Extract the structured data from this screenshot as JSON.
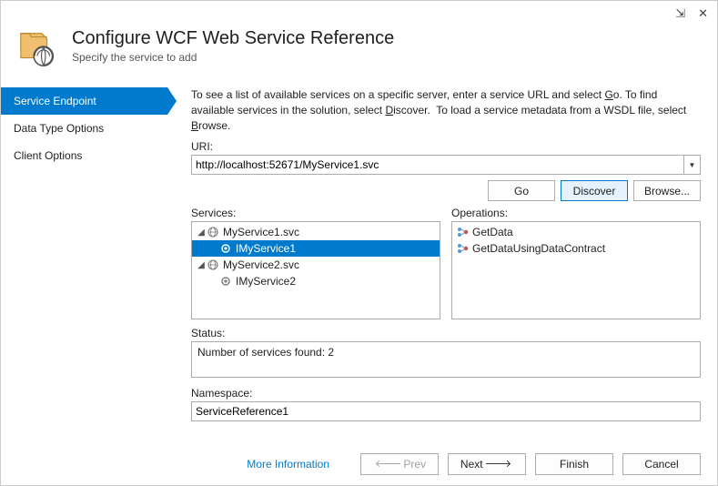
{
  "header": {
    "title": "Configure WCF Web Service Reference",
    "subtitle": "Specify the service to add"
  },
  "sidebar": {
    "items": [
      {
        "label": "Service Endpoint",
        "active": true
      },
      {
        "label": "Data Type Options",
        "active": false
      },
      {
        "label": "Client Options",
        "active": false
      }
    ]
  },
  "content": {
    "instructions": "To see a list of available services on a specific server, enter a service URL and select Go. To find available services in the solution, select Discover.  To load a service metadata from a WSDL file, select Browse.",
    "uri_label": "URI:",
    "uri_placeholder": "",
    "uri_value": "http://localhost:52671/MyService1.svc",
    "buttons": {
      "go": "Go",
      "discover": "Discover",
      "browse": "Browse..."
    },
    "services_label": "Services:",
    "operations_label": "Operations:",
    "services_tree": [
      {
        "name": "MyService1.svc",
        "children": [
          {
            "name": "IMyService1",
            "selected": true
          }
        ]
      },
      {
        "name": "MyService2.svc",
        "children": [
          {
            "name": "IMyService2",
            "selected": false
          }
        ]
      }
    ],
    "operations": [
      "GetData",
      "GetDataUsingDataContract"
    ],
    "status_label": "Status:",
    "status_text": "Number of services found: 2",
    "namespace_label": "Namespace:",
    "namespace_value": "ServiceReference1"
  },
  "footer": {
    "more_info": "More Information",
    "prev": "Prev",
    "next": "Next",
    "finish": "Finish",
    "cancel": "Cancel"
  }
}
